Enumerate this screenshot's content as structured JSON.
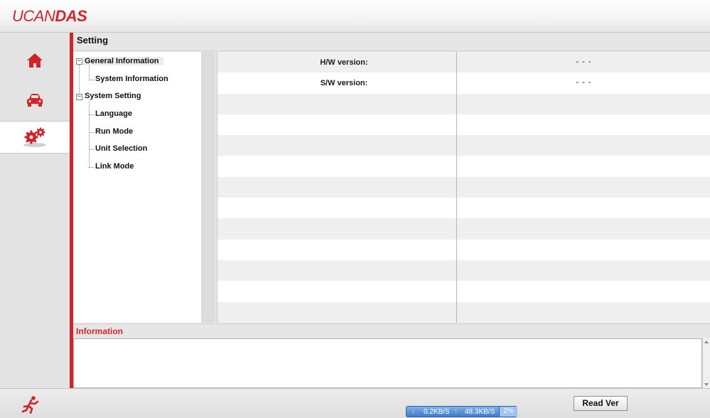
{
  "app": {
    "logo_regular": "UCAN",
    "logo_bold": "DAS"
  },
  "page": {
    "title": "Setting"
  },
  "sidebar": {
    "items": [
      {
        "icon": "home-icon",
        "active": false
      },
      {
        "icon": "car-icon",
        "active": false
      },
      {
        "icon": "gears-icon",
        "active": true
      }
    ]
  },
  "tree": {
    "general_information": "General Information",
    "system_information": "System Information",
    "system_setting": "System Setting",
    "language": "Language",
    "run_mode": "Run Mode",
    "unit_selection": "Unit Selection",
    "link_mode": "Link Mode",
    "expander_symbol": "−"
  },
  "grid": {
    "rows": [
      {
        "label": "H/W version:",
        "value": "- - -"
      },
      {
        "label": "S/W version:",
        "value": "- - -"
      }
    ]
  },
  "information": {
    "title": "Information"
  },
  "footer": {
    "exit_icon": "exit-running-man-icon",
    "download_speed": "0.2KB/S",
    "upload_speed": "48.3KB/S",
    "percent": "2%",
    "read_ver_label": "Read Ver"
  },
  "colors": {
    "brand_red": "#d2232a",
    "net_widget_blue": "#3f7ccc"
  }
}
